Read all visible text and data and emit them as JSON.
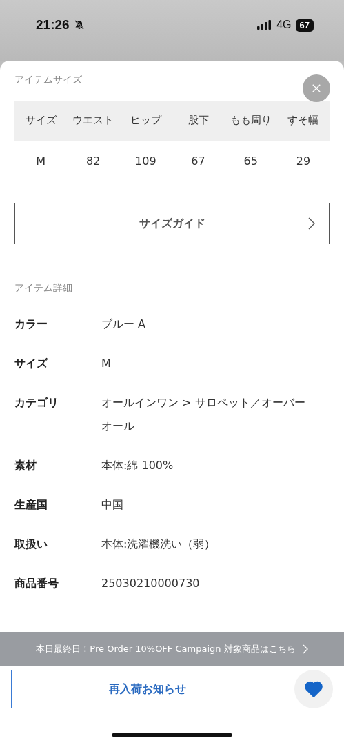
{
  "status_bar": {
    "time": "21:26",
    "network": "4G",
    "battery": "67"
  },
  "size_section": {
    "title": "アイテムサイズ"
  },
  "size_table": {
    "columns": [
      "サイズ",
      "ウエスト",
      "ヒップ",
      "股下",
      "もも周り",
      "すそ幅"
    ],
    "rows": [
      [
        "M",
        "82",
        "109",
        "67",
        "65",
        "29"
      ]
    ]
  },
  "size_guide_button": {
    "label": "サイズガイド"
  },
  "details_section": {
    "title": "アイテム詳細",
    "rows": [
      {
        "label": "カラー",
        "value": "ブルー A"
      },
      {
        "label": "サイズ",
        "value": "M"
      },
      {
        "label": "カテゴリ",
        "value": "オールインワン > サロペット／オーバーオール"
      },
      {
        "label": "素材",
        "value": "本体:綿 100%"
      },
      {
        "label": "生産国",
        "value": "中国"
      },
      {
        "label": "取扱い",
        "value": "本体:洗濯機洗い（弱）"
      },
      {
        "label": "商品番号",
        "value": "25030210000730"
      }
    ]
  },
  "campaign_banner": {
    "text": "本日最終日！Pre Order 10%OFF Campaign 対象商品はこちら"
  },
  "restock_button": {
    "label": "再入荷お知らせ"
  },
  "favorite": {
    "selected": true
  }
}
